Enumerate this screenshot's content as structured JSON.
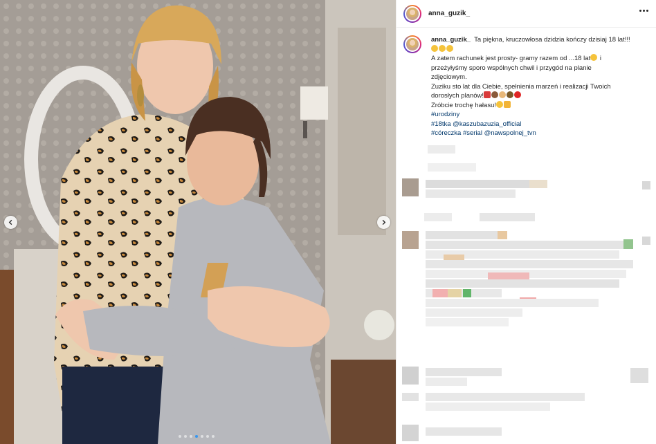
{
  "post": {
    "username": "anna_guzik_",
    "caption_headline": "Ta piękna, kruczowłosa dzidzia kończy dzisiaj 18 lat!!!",
    "caption_lines": [
      "A zatem rachunek jest prosty- gramy razem od ...18 lat",
      "i",
      "przeżyłyśmy sporo wspólnych chwil i przygód na planie",
      "zdjęciowym.",
      "Zuziku sto lat dla Ciebie, spełnienia marzeń i realizacji Twoich",
      "dorosłych planów!",
      "Zróbcie trochę hałasu!"
    ],
    "hashtags": {
      "line1": "#urodziny",
      "line2_tag": "#18tka",
      "line2_mention": "@kaszubazuzia_official",
      "line3_tag1": "#córeczka",
      "line3_tag2": "#serial",
      "line3_mention": "@nawspolnej_tvn"
    }
  },
  "carousel": {
    "slide_count": 7,
    "active_index": 3
  },
  "colors": {
    "link": "#00376b",
    "text": "#262626",
    "dot_active": "#3897f0"
  },
  "icons": {
    "more": "more-options-icon",
    "prev": "chevron-left-icon",
    "next": "chevron-right-icon"
  }
}
